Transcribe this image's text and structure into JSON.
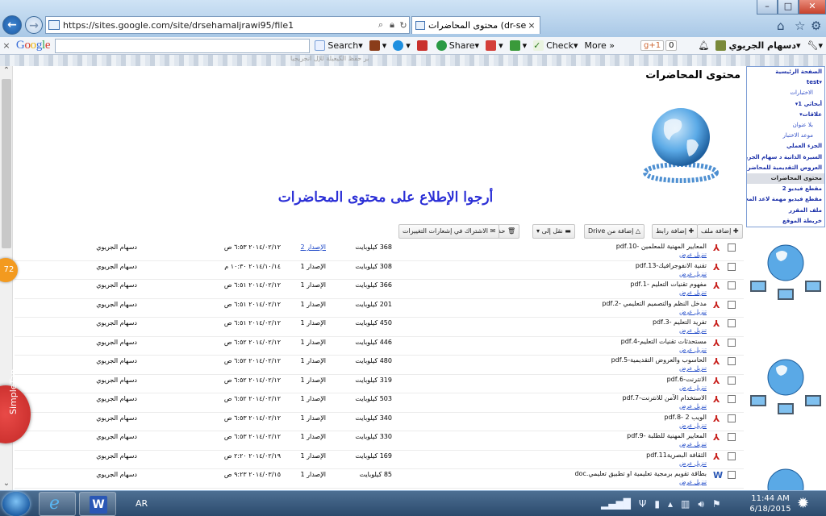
{
  "browser": {
    "url": "https://sites.google.com/site/drsehamaljrawi95/file1",
    "tab_title": "محتوى المحاضرات (dr-seham ...",
    "tab_close": "×",
    "back": "←",
    "forward": "→",
    "window_controls": {
      "minimize": "–",
      "maximize": "□",
      "close": "✕"
    }
  },
  "google_toolbar": {
    "close": "×",
    "search_label": "Search",
    "share_label": "Share",
    "check_label": "Check",
    "more_label": "More »",
    "gplus": "g+1",
    "gplus_count": "0",
    "user_name": "دسهام الجريوي"
  },
  "site": {
    "page_title": "محتوى المحاضرات",
    "headline": "أرجوا الإطلاع على محتوى المحاضرات",
    "strip_caption": "بر حقظ الكيعيلة للإل انجريجيا"
  },
  "actions": {
    "add_file": "إضافة ملف",
    "add_link": "إضافة رابط",
    "add_from_drive": "إضافة من Drive",
    "move_to": "نقل إلى",
    "delete": "حذف",
    "subscribe": "الاشتراك في إشعارات التغييرات"
  },
  "file_links": {
    "download": "تنزيل",
    "view": "عرض"
  },
  "files": [
    {
      "name": "المعايير المهنية للمعلمين -10.pdf",
      "size": "368 كيلوبايت",
      "version": "الإصدار 2",
      "version_link": true,
      "date": "٢٠١٤/٠٢/١٢ ٦:٥٣ ص",
      "owner": "دسهام الجريوي",
      "icon": "pdf"
    },
    {
      "name": "تقنية الانفوجرافيك-13.pdf",
      "size": "308 كيلوبايت",
      "version": "الإصدار 1",
      "version_link": false,
      "date": "٢٠١٤/١٠/١٤ ١٠:٣٠ م",
      "owner": "دسهام الجريوي",
      "icon": "pdf"
    },
    {
      "name": "مفهوم تقنيات التعليم -1.pdf",
      "size": "366 كيلوبايت",
      "version": "الإصدار 1",
      "version_link": false,
      "date": "٢٠١٤/٠٢/١٢ ٦:٥١ ص",
      "owner": "دسهام الجريوي",
      "icon": "pdf"
    },
    {
      "name": "مدخل النظم والتصميم التعليمي -2.pdf",
      "size": "201 كيلوبايت",
      "version": "الإصدار 1",
      "version_link": false,
      "date": "٢٠١٤/٠٢/١٢ ٦:٥١ ص",
      "owner": "دسهام الجريوي",
      "icon": "pdf"
    },
    {
      "name": "تفريد التعليم -3.pdf",
      "size": "450 كيلوبايت",
      "version": "الإصدار 1",
      "version_link": false,
      "date": "٢٠١٤/٠٢/١٢ ٦:٥١ ص",
      "owner": "دسهام الجريوي",
      "icon": "pdf"
    },
    {
      "name": "مستحدثات تقنيات التعليم-4.pdf",
      "size": "446 كيلوبايت",
      "version": "الإصدار 1",
      "version_link": false,
      "date": "٢٠١٤/٠٢/١٢ ٦:٥٢ ص",
      "owner": "دسهام الجريوي",
      "icon": "pdf"
    },
    {
      "name": "الحاسوب والعروض التقديمية-5.pdf",
      "size": "480 كيلوبايت",
      "version": "الإصدار 1",
      "version_link": false,
      "date": "٢٠١٤/٠٢/١٢ ٦:٥٢ ص",
      "owner": "دسهام الجريوي",
      "icon": "pdf"
    },
    {
      "name": "الانترنت-6.pdf",
      "size": "319 كيلوبايت",
      "version": "الإصدار 1",
      "version_link": false,
      "date": "٢٠١٤/٠٢/١٢ ٦:٥٢ ص",
      "owner": "دسهام الجريوي",
      "icon": "pdf"
    },
    {
      "name": "الاستخدام الآمن للانترنت-7.pdf",
      "size": "503 كيلوبايت",
      "version": "الإصدار 1",
      "version_link": false,
      "date": "٢٠١٤/٠٢/١٢ ٦:٥٢ ص",
      "owner": "دسهام الجريوي",
      "icon": "pdf"
    },
    {
      "name": "الويب 2 -8.pdf",
      "size": "340 كيلوبايت",
      "version": "الإصدار 1",
      "version_link": false,
      "date": "٢٠١٤/٠٢/١٢ ٦:٥٣ ص",
      "owner": "دسهام الجريوي",
      "icon": "pdf"
    },
    {
      "name": "المعايير المهنية للطلبة -9.pdf",
      "size": "330 كيلوبايت",
      "version": "الإصدار 1",
      "version_link": false,
      "date": "٢٠١٤/٠٢/١٢ ٦:٥٣ ص",
      "owner": "دسهام الجريوي",
      "icon": "pdf"
    },
    {
      "name": "الثقافة البصرية11.pdf",
      "size": "169 كيلوبايت",
      "version": "الإصدار 1",
      "version_link": false,
      "date": "٢٠١٤/٠٢/١٩ ٢:٢٠ ص",
      "owner": "دسهام الجريوي",
      "icon": "pdf"
    },
    {
      "name": "بطاقة تقويم برمجية تعليمية او تطبيق تعليمي.doc",
      "size": "85 كيلوبايت",
      "version": "الإصدار 1",
      "version_link": false,
      "date": "٢٠١٤/٠٣/١٥ ٩:٢٣ ص",
      "owner": "دسهام الجريوي",
      "icon": "word"
    }
  ],
  "sidebar": {
    "items": [
      {
        "label": "الصفحة الرئيسية",
        "level": 0,
        "bold": true,
        "active": false
      },
      {
        "label": "▾test",
        "level": 0,
        "bold": true,
        "active": false
      },
      {
        "label": "الاختبارات",
        "level": 1,
        "bold": false,
        "active": false
      },
      {
        "label": "أبحاثي 1▾",
        "level": 0,
        "bold": true,
        "active": false
      },
      {
        "label": "علاقات▾",
        "level": 0,
        "bold": true,
        "active": false
      },
      {
        "label": "بلا عنوان",
        "level": 1,
        "bold": false,
        "active": false
      },
      {
        "label": "موعد الاختبار",
        "level": 1,
        "bold": false,
        "active": false
      },
      {
        "label": "الجزء العملي",
        "level": 0,
        "bold": true,
        "active": false
      },
      {
        "label": "السيرة الذاتية د سهام الجريوي",
        "level": 0,
        "bold": true,
        "active": false
      },
      {
        "label": "العروض التقديمية للمحاضرات",
        "level": 0,
        "bold": true,
        "active": false
      },
      {
        "label": "محتوى المحاضرات",
        "level": 0,
        "bold": true,
        "active": true
      },
      {
        "label": "مقطع فيديو 2",
        "level": 0,
        "bold": true,
        "active": false
      },
      {
        "label": "مقطع فيديو مهمة لاعد المحاضرات",
        "level": 0,
        "bold": true,
        "active": false
      },
      {
        "label": "ملف المقرر",
        "level": 0,
        "bold": true,
        "active": false
      },
      {
        "label": "خريطة الموقع",
        "level": 0,
        "bold": true,
        "active": false
      }
    ]
  },
  "overlays": {
    "badge": "72",
    "simpletap": "SimpleTap"
  },
  "taskbar": {
    "language": "AR",
    "time": "11:44 AM",
    "date": "6/18/2015"
  },
  "colors": {
    "headline": "#2b2fd6",
    "link": "#1a45c7",
    "pdf_icon": "#c8211d",
    "simpletap": "#c22826",
    "badge": "#f39a1f"
  }
}
